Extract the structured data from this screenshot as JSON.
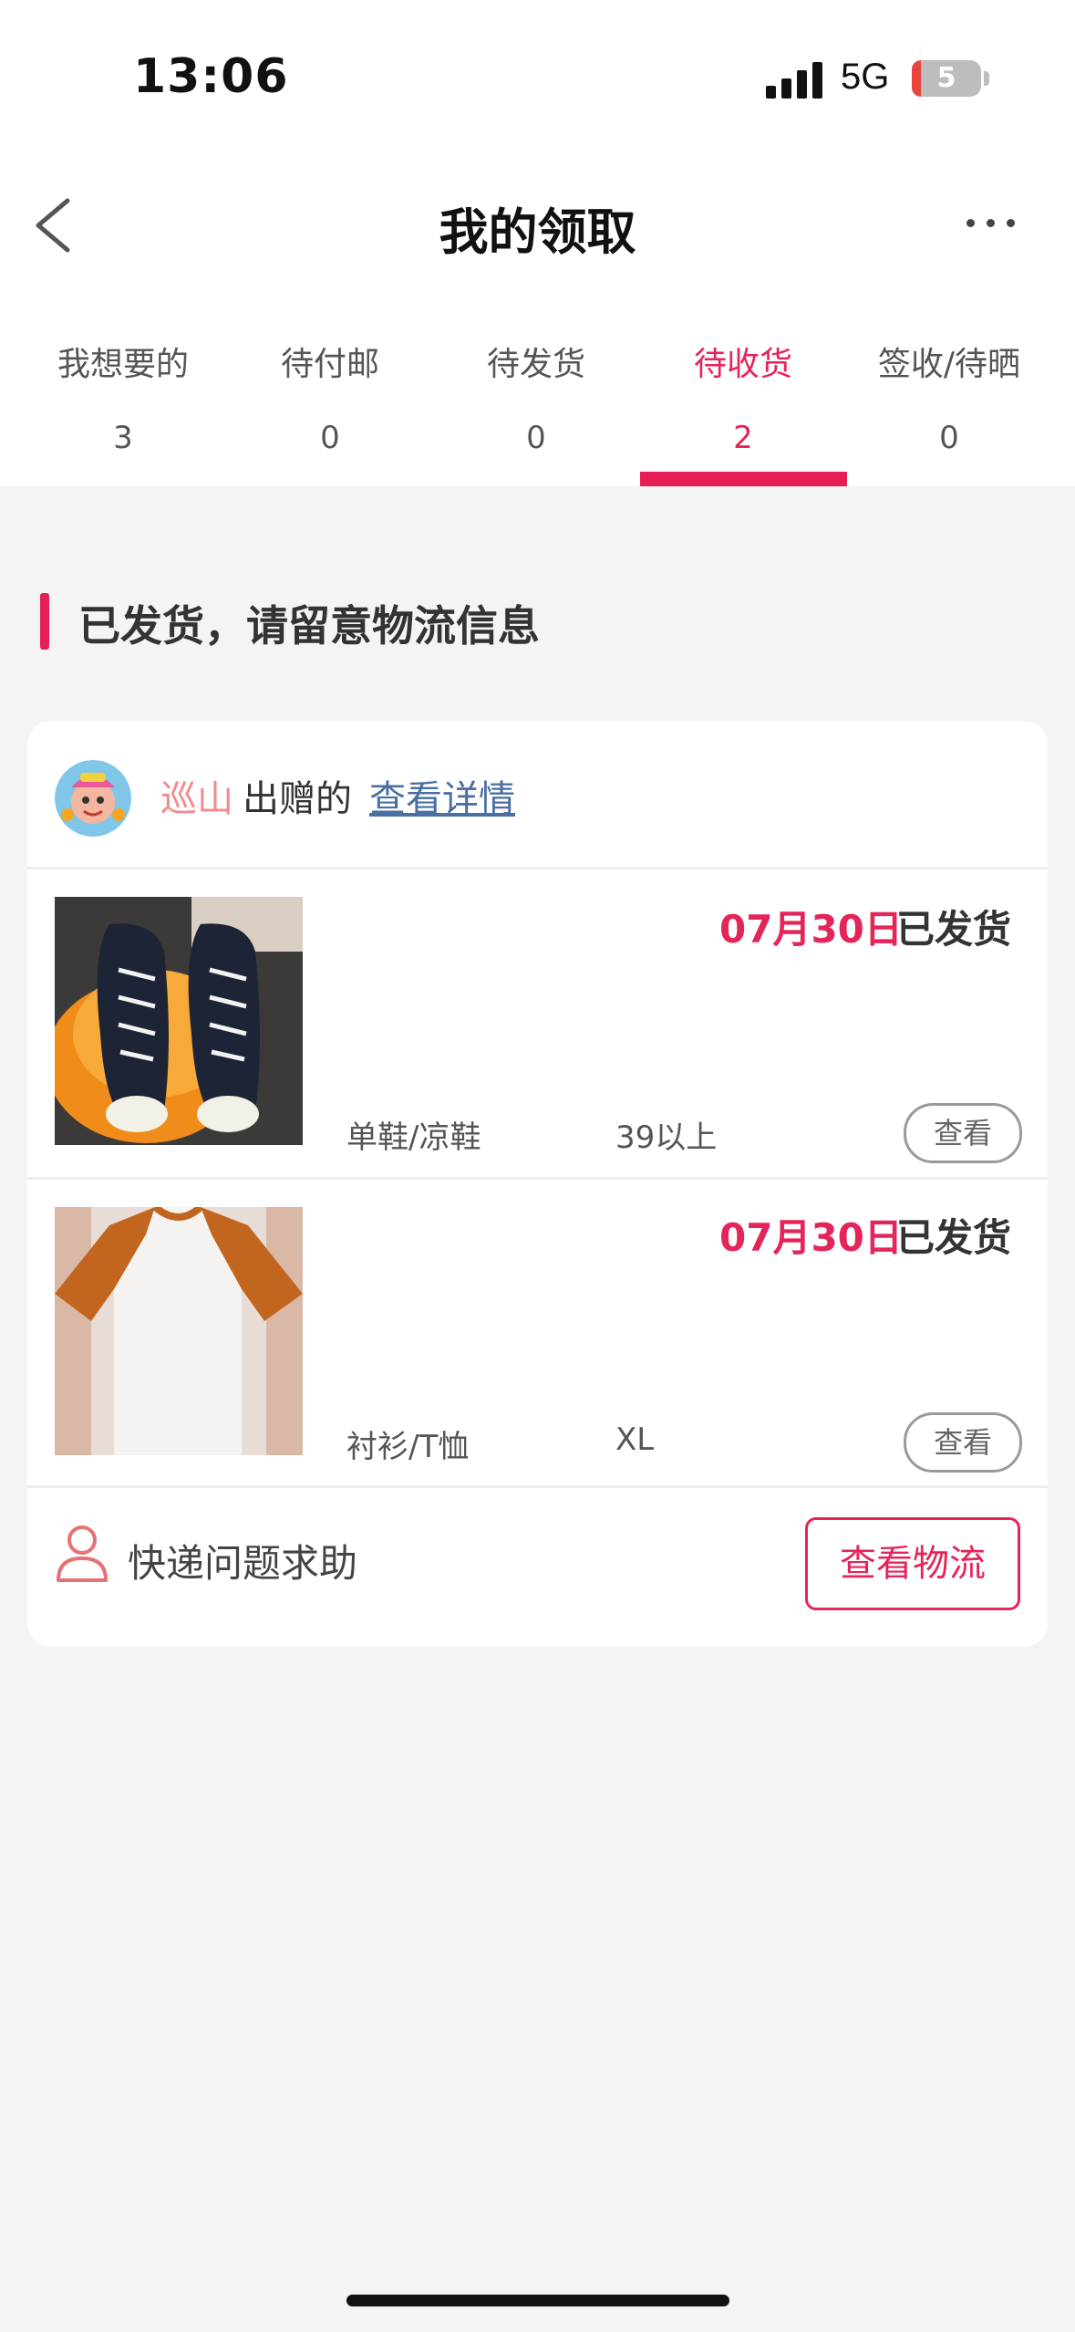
{
  "status_bar": {
    "time": "13:06",
    "network": "5G",
    "battery": "5"
  },
  "nav": {
    "title": "我的领取",
    "back_icon": "chevron-left-icon",
    "more_icon": "more-dots-icon"
  },
  "tabs": [
    {
      "label": "我想要的",
      "count": "3"
    },
    {
      "label": "待付邮",
      "count": "0"
    },
    {
      "label": "待发货",
      "count": "0"
    },
    {
      "label": "待收货",
      "count": "2",
      "active": true
    },
    {
      "label": "签收/待晒",
      "count": "0"
    }
  ],
  "section": {
    "title": "已发货，请留意物流信息"
  },
  "order": {
    "donor": "巡山",
    "donor_suffix": "出赠的",
    "detail_link": "查看详情",
    "items": [
      {
        "image": "sneakers-photo",
        "date": "07月30日",
        "status": "已发货",
        "category": "单鞋/凉鞋",
        "size": "39以上",
        "view_label": "查看"
      },
      {
        "image": "tshirt-photo",
        "date": "07月30日",
        "status": "已发货",
        "category": "衬衫/T恤",
        "size": "XL",
        "view_label": "查看"
      }
    ],
    "help_text": "快递问题求助",
    "logistics_label": "查看物流"
  },
  "colors": {
    "accent": "#e5245a",
    "donor": "#ef8c8f",
    "link": "#4a6fa1",
    "background": "#f4f4f4"
  }
}
